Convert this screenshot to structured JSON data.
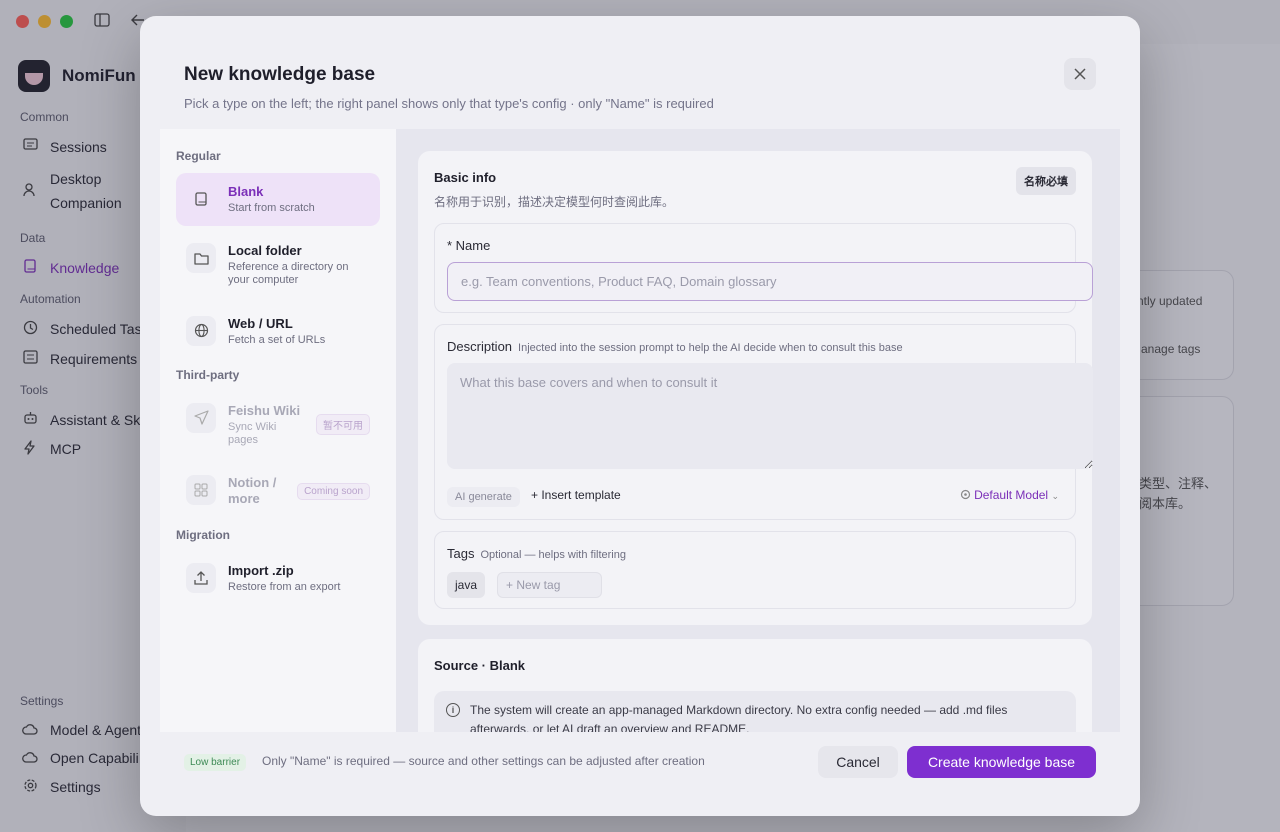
{
  "app": {
    "name": "NomiFun",
    "sidebar": {
      "sections": [
        {
          "label": "Common",
          "items": [
            {
              "label": "Sessions",
              "icon": "chat-icon"
            },
            {
              "label": "Desktop Companion",
              "icon": "person-icon"
            }
          ]
        },
        {
          "label": "Data",
          "items": [
            {
              "label": "Knowledge",
              "icon": "book-icon",
              "active": true
            }
          ]
        },
        {
          "label": "Automation",
          "items": [
            {
              "label": "Scheduled Tas",
              "icon": "clock-icon"
            },
            {
              "label": "Requirements",
              "icon": "list-icon"
            }
          ]
        },
        {
          "label": "Tools",
          "items": [
            {
              "label": "Assistant & Sk",
              "icon": "robot-icon"
            },
            {
              "label": "MCP",
              "icon": "bolt-icon"
            }
          ]
        }
      ],
      "settings_section": {
        "label": "Settings",
        "items": [
          {
            "label": "Model & Agent",
            "icon": "cloud-icon"
          },
          {
            "label": "Open Capabili",
            "icon": "cloud-icon"
          },
          {
            "label": "Settings",
            "icon": "gear-icon"
          }
        ]
      }
    },
    "background_fragments": {
      "sort": "ntly updated",
      "manage_tags": "anage tags",
      "cn_line1": "类型、注释、",
      "cn_line2": "阅本库。"
    }
  },
  "modal": {
    "title": "New knowledge base",
    "subtitle": "Pick a type on the left; the right panel shows only that type's config · only \"Name\" is required",
    "left": {
      "groups": [
        {
          "label": "Regular",
          "items": [
            {
              "name": "Blank",
              "desc": "Start from scratch",
              "icon": "book-icon",
              "selected": true
            },
            {
              "name": "Local folder",
              "desc": "Reference a directory on your computer",
              "icon": "folder-icon"
            },
            {
              "name": "Web / URL",
              "desc": "Fetch a set of URLs",
              "icon": "globe-icon"
            }
          ]
        },
        {
          "label": "Third-party",
          "items": [
            {
              "name": "Feishu Wiki",
              "desc": "Sync Wiki pages",
              "icon": "send-icon",
              "disabled": true,
              "badge": "暂不可用"
            },
            {
              "name": "Notion / more",
              "desc": "",
              "icon": "grid-icon",
              "disabled": true,
              "badge": "Coming soon"
            }
          ]
        },
        {
          "label": "Migration",
          "items": [
            {
              "name": "Import .zip",
              "desc": "Restore from an export",
              "icon": "upload-icon"
            }
          ]
        }
      ]
    },
    "basic": {
      "title": "Basic info",
      "desc": "名称用于识别，描述决定模型何时查阅此库。",
      "required_badge": "名称必填",
      "name_label": "* Name",
      "name_placeholder": "e.g. Team conventions, Product FAQ, Domain glossary",
      "description_label": "Description",
      "description_hint": "Injected into the session prompt to help the AI decide when to consult this base",
      "description_placeholder": "What this base covers and when to consult it",
      "ai_generate": "AI generate",
      "insert_template": "+ Insert template",
      "model": "Default Model",
      "tags_label": "Tags",
      "tags_hint": "Optional — helps with filtering",
      "tags": [
        "java"
      ],
      "new_tag_placeholder": "+ New tag"
    },
    "source": {
      "title": "Source · Blank",
      "info": "The system will create an app-managed Markdown directory. No extra config needed — add .md files afterwards, or let AI draft an overview and README."
    },
    "footer": {
      "badge": "Low barrier",
      "note": "Only \"Name\" is required — source and other settings can be adjusted after creation",
      "cancel": "Cancel",
      "create": "Create knowledge base"
    }
  }
}
